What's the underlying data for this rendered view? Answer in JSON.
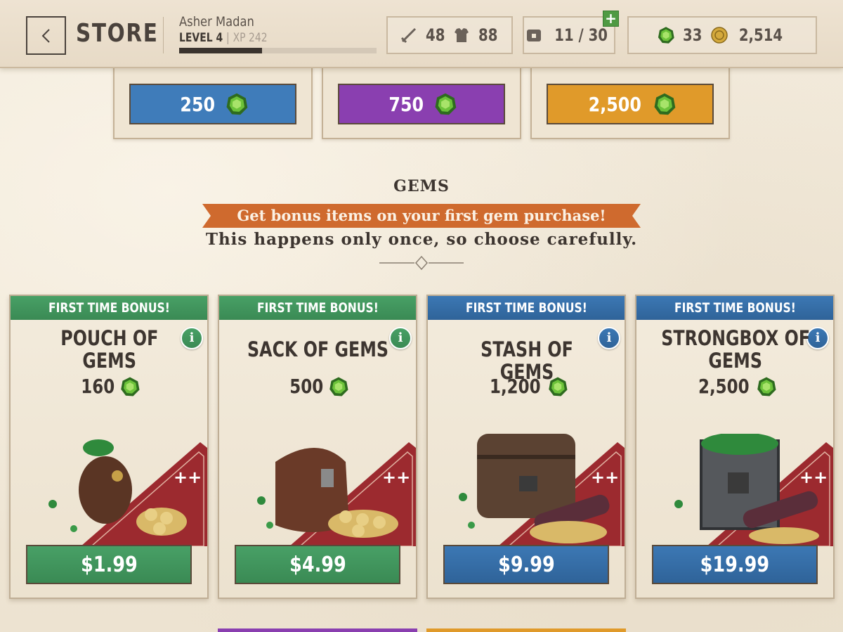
{
  "header": {
    "title": "STORE",
    "player_name": "Asher Madan",
    "level_label": "LEVEL 4",
    "separator": "|",
    "xp_label": "XP 242",
    "xp_progress": 0.42,
    "attack": "48",
    "armor": "88",
    "inventory": "11 / 30",
    "gems": "33",
    "gold": "2,514",
    "plus": "+"
  },
  "upper_offers": [
    {
      "amount": "250",
      "color": "#3f7cba"
    },
    {
      "amount": "750",
      "color": "#8a3fb0"
    },
    {
      "amount": "2,500",
      "color": "#e09a2a"
    }
  ],
  "section": {
    "title": "GEMS",
    "ribbon": "Get bonus items on your first gem purchase!",
    "subtitle": "This happens only once, so choose carefully."
  },
  "cards": [
    {
      "banner": "FIRST TIME BONUS!",
      "name_line1": "POUCH OF",
      "name_line2": "GEMS",
      "amount": "160",
      "price": "$1.99",
      "info": "i",
      "theme": "green"
    },
    {
      "banner": "FIRST TIME BONUS!",
      "name_line1": "SACK OF GEMS",
      "name_line2": "",
      "amount": "500",
      "price": "$4.99",
      "info": "i",
      "theme": "green"
    },
    {
      "banner": "FIRST TIME BONUS!",
      "name_line1": "STASH OF GEMS",
      "name_line2": "",
      "amount": "1,200",
      "price": "$9.99",
      "info": "i",
      "theme": "blue"
    },
    {
      "banner": "FIRST TIME BONUS!",
      "name_line1": "STRONGBOX OF",
      "name_line2": "GEMS",
      "amount": "2,500",
      "price": "$19.99",
      "info": "i",
      "theme": "blue"
    }
  ],
  "colors": {
    "green": "#48a066",
    "blue": "#3c78b4",
    "ribbon": "#cf6a2e",
    "gem": "#58a83a"
  }
}
